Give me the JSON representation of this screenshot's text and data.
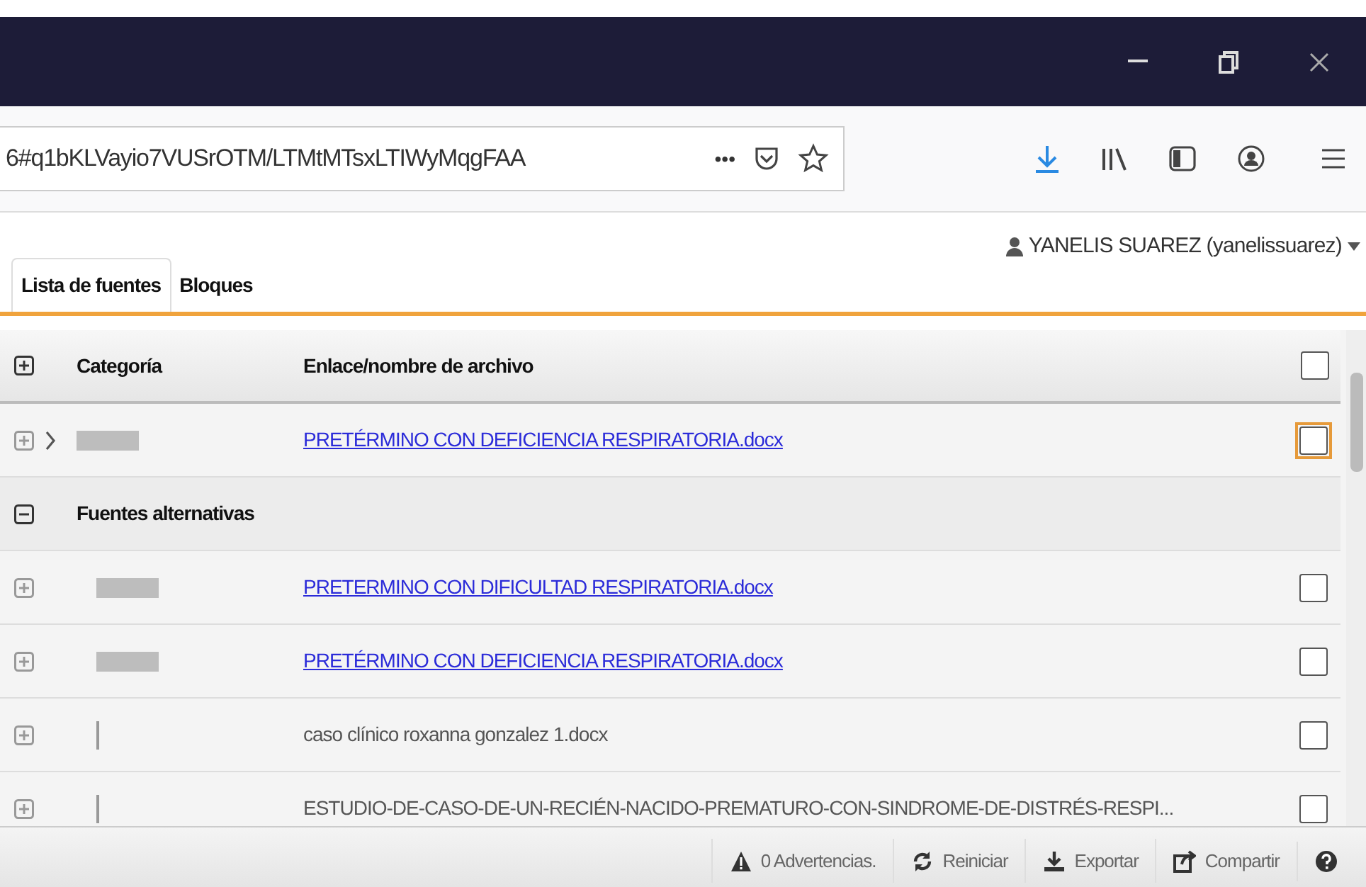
{
  "browser": {
    "url": "6#q1bKLVayio7VUSrOTM/LTMtMTsxLTIWyMqgFAA",
    "more": "•••"
  },
  "tabs": [
    {
      "label": "Lista de fuentes",
      "selected": true
    },
    {
      "label": "Bloques",
      "selected": false
    }
  ],
  "user": "YANELIS SUAREZ (yanelissuarez)",
  "table": {
    "columns": [
      "Categoría",
      "Enlace/nombre de archivo"
    ],
    "header_checked": false,
    "rows": [
      {
        "kind": "item",
        "expandable": true,
        "category": {
          "kind": "block"
        },
        "text": "PRETÉRMINO CON DEFICIENCIA RESPIRATORIA.docx",
        "link": true,
        "checked": false,
        "focused": true
      },
      {
        "kind": "group",
        "expanded": true,
        "text": "Fuentes alternativas"
      },
      {
        "kind": "item",
        "expandable": false,
        "category": {
          "kind": "block"
        },
        "text": "PRETERMINO CON DIFICULTAD RESPIRATORIA.docx",
        "link": true,
        "checked": false,
        "focused": false
      },
      {
        "kind": "item",
        "expandable": false,
        "category": {
          "kind": "block"
        },
        "text": "PRETÉRMINO CON DEFICIENCIA RESPIRATORIA.docx",
        "link": true,
        "checked": false,
        "focused": false
      },
      {
        "kind": "item",
        "expandable": false,
        "category": {
          "kind": "line"
        },
        "text": "caso clínico roxanna gonzalez 1.docx",
        "link": false,
        "checked": false,
        "focused": false
      },
      {
        "kind": "item",
        "expandable": false,
        "category": {
          "kind": "line"
        },
        "text": "ESTUDIO-DE-CASO-DE-UN-RECIÉN-NACIDO-PREMATURO-CON-SINDROME-DE-DISTRÉS-RESPI...",
        "link": false,
        "checked": false,
        "focused": false
      }
    ]
  },
  "footer": {
    "warnings": "0 Advertencias.",
    "reset": "Reiniciar",
    "export": "Exportar",
    "share": "Compartir"
  }
}
